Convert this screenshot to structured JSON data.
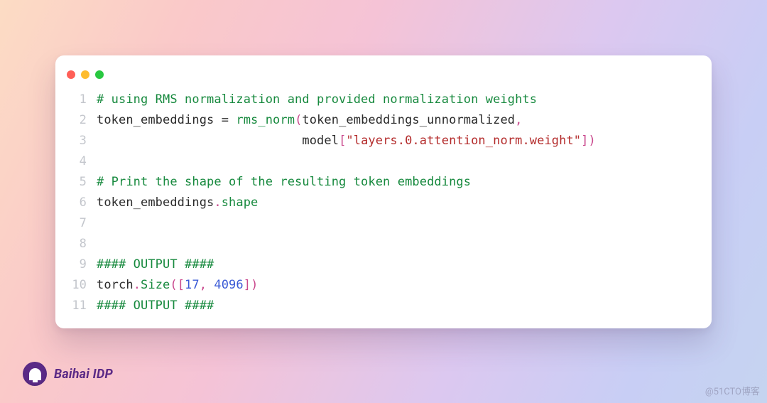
{
  "code": {
    "lines": [
      {
        "num": "1",
        "tokens": [
          {
            "cls": "cmt",
            "t": "# using RMS normalization and provided normalization weights"
          }
        ]
      },
      {
        "num": "2",
        "tokens": [
          {
            "cls": "plain",
            "t": "token_embeddings "
          },
          {
            "cls": "op",
            "t": "= "
          },
          {
            "cls": "fn",
            "t": "rms_norm"
          },
          {
            "cls": "punct",
            "t": "("
          },
          {
            "cls": "plain",
            "t": "token_embeddings_unnormalized"
          },
          {
            "cls": "punct",
            "t": ","
          }
        ]
      },
      {
        "num": "3",
        "tokens": [
          {
            "cls": "plain",
            "t": "                            model"
          },
          {
            "cls": "punct",
            "t": "["
          },
          {
            "cls": "str",
            "t": "\"layers.0.attention_norm.weight\""
          },
          {
            "cls": "punct",
            "t": "])"
          }
        ]
      },
      {
        "num": "4",
        "tokens": [
          {
            "cls": "plain",
            "t": ""
          }
        ]
      },
      {
        "num": "5",
        "tokens": [
          {
            "cls": "cmt",
            "t": "# Print the shape of the resulting token embeddings"
          }
        ]
      },
      {
        "num": "6",
        "tokens": [
          {
            "cls": "plain",
            "t": "token_embeddings"
          },
          {
            "cls": "punct",
            "t": "."
          },
          {
            "cls": "kw-prop",
            "t": "shape"
          }
        ]
      },
      {
        "num": "7",
        "tokens": [
          {
            "cls": "plain",
            "t": ""
          }
        ]
      },
      {
        "num": "8",
        "tokens": [
          {
            "cls": "plain",
            "t": ""
          }
        ]
      },
      {
        "num": "9",
        "tokens": [
          {
            "cls": "cmt",
            "t": "#### OUTPUT ####"
          }
        ]
      },
      {
        "num": "10",
        "tokens": [
          {
            "cls": "plain",
            "t": "torch"
          },
          {
            "cls": "punct",
            "t": "."
          },
          {
            "cls": "fn",
            "t": "Size"
          },
          {
            "cls": "punct",
            "t": "(["
          },
          {
            "cls": "num",
            "t": "17"
          },
          {
            "cls": "punct",
            "t": ", "
          },
          {
            "cls": "num",
            "t": "4096"
          },
          {
            "cls": "punct",
            "t": "])"
          }
        ]
      },
      {
        "num": "11",
        "tokens": [
          {
            "cls": "cmt",
            "t": "#### OUTPUT ####"
          }
        ]
      }
    ]
  },
  "brand": {
    "name": "Baihai IDP"
  },
  "attribution": "@51CTO博客"
}
